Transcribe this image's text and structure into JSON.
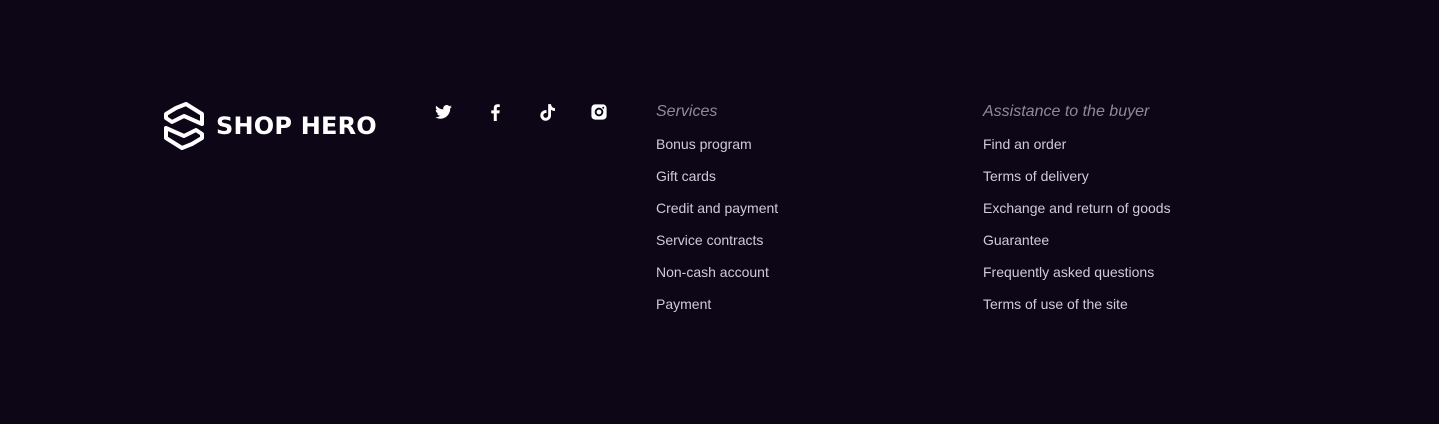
{
  "brand": {
    "name": "SHOP HERO",
    "icon": "shop-hero-logo-icon"
  },
  "socials": [
    {
      "name": "twitter",
      "icon": "twitter-icon"
    },
    {
      "name": "facebook",
      "icon": "facebook-icon"
    },
    {
      "name": "tiktok",
      "icon": "tiktok-icon"
    },
    {
      "name": "instagram",
      "icon": "instagram-icon"
    }
  ],
  "services": {
    "title": "Services",
    "links": [
      "Bonus program",
      "Gift cards",
      "Credit and payment",
      "Service contracts",
      "Non-cash account",
      "Payment"
    ]
  },
  "buyer": {
    "title": "Assistance to the buyer",
    "links": [
      "Find an order",
      "Terms of delivery",
      "Exchange and return of goods",
      "Guarantee",
      "Frequently asked questions",
      "Terms of use of the site"
    ]
  },
  "colors": {
    "background": "#0d0617",
    "heading": "#8e8a99",
    "link": "#cfcbd8",
    "logo": "#ffffff"
  }
}
